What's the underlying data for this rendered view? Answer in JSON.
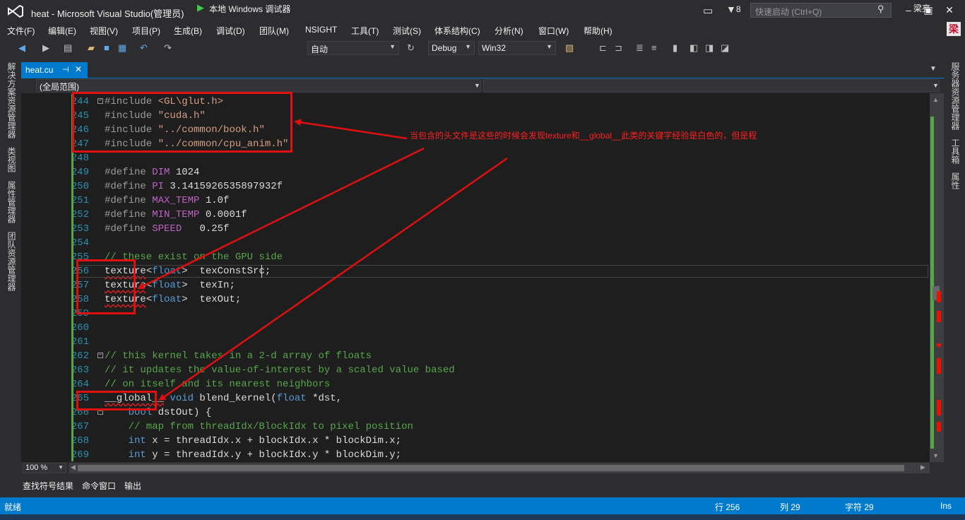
{
  "window": {
    "title": "heat - Microsoft Visual Studio(管理员)",
    "notification_count": "8",
    "quick_launch_placeholder": "快速启动 (Ctrl+Q)",
    "user_name": "梁亮",
    "user_avatar_char": "梁"
  },
  "menu": [
    "文件(F)",
    "编辑(E)",
    "视图(V)",
    "项目(P)",
    "生成(B)",
    "调试(D)",
    "团队(M)",
    "NSIGHT",
    "工具(T)",
    "测试(S)",
    "体系结构(C)",
    "分析(N)",
    "窗口(W)",
    "帮助(H)"
  ],
  "toolbar": {
    "start_debug_label": "本地 Windows 调试器",
    "solution_config": "自动",
    "configuration": "Debug",
    "platform": "Win32"
  },
  "left_tool_tabs": [
    "解决方案资源管理器",
    "类视图",
    "属性管理器",
    "团队资源管理器"
  ],
  "right_tool_tabs": [
    "服务器资源管理器",
    "工具箱",
    "属性"
  ],
  "document_tab": {
    "name": "heat.cu"
  },
  "navigation": {
    "scope": "(全局范围)"
  },
  "code": {
    "l244_n": "244",
    "l244_a": "#include ",
    "l244_b": "<GL\\glut.h>",
    "l245_n": "245",
    "l245_a": "#include ",
    "l245_b": "\"cuda.h\"",
    "l246_n": "246",
    "l246_a": "#include ",
    "l246_b": "\"../common/book.h\"",
    "l247_n": "247",
    "l247_a": "#include ",
    "l247_b": "\"../common/cpu_anim.h\"",
    "l248_n": "248",
    "l249_n": "249",
    "l249_a": "#define ",
    "l249_m": "DIM",
    "l249_v": " 1024",
    "l250_n": "250",
    "l250_a": "#define ",
    "l250_m": "PI",
    "l250_v": " 3.1415926535897932f",
    "l251_n": "251",
    "l251_a": "#define ",
    "l251_m": "MAX_TEMP",
    "l251_v": " 1.0f",
    "l252_n": "252",
    "l252_a": "#define ",
    "l252_m": "MIN_TEMP",
    "l252_v": " 0.0001f",
    "l253_n": "253",
    "l253_a": "#define ",
    "l253_m": "SPEED",
    "l253_v": "   0.25f",
    "l254_n": "254",
    "l255_n": "255",
    "l255_c": "// these exist on the GPU side",
    "l256_n": "256",
    "l256_a": "texture",
    "l256_b": "<",
    "l256_k": "float",
    "l256_c": ">  texConstSrc;",
    "l257_n": "257",
    "l257_a": "texture",
    "l257_b": "<",
    "l257_k": "float",
    "l257_c": ">  texIn;",
    "l258_n": "258",
    "l258_a": "texture",
    "l258_b": "<",
    "l258_k": "float",
    "l258_c": ">  texOut;",
    "l259_n": "259",
    "l260_n": "260",
    "l261_n": "261",
    "l262_n": "262",
    "l262_c": "// this kernel takes in a 2-d array of floats",
    "l263_n": "263",
    "l263_c": "// it updates the value-of-interest by a scaled value based",
    "l264_n": "264",
    "l264_c": "// on itself and its nearest neighbors",
    "l265_n": "265",
    "l265_a": "__global__",
    "l265_b": " ",
    "l265_k": "void",
    "l265_c": " blend_kernel(",
    "l265_k2": "float",
    "l265_d": " *dst,",
    "l266_n": "266",
    "l266_a": "    ",
    "l266_k": "bool",
    "l266_c": " dstOut) {",
    "l267_n": "267",
    "l267_c": "    // map from threadIdx/BlockIdx to pixel position",
    "l268_n": "268",
    "l268_a": "    ",
    "l268_k": "int",
    "l268_c": " x = threadIdx.x + blockIdx.x * blockDim.x;",
    "l269_n": "269",
    "l269_a": "    ",
    "l269_k": "int",
    "l269_c": " y = threadIdx.y + blockIdx.y * blockDim.y;"
  },
  "editor": {
    "zoom": "100 %"
  },
  "bottom_tabs": [
    "查找符号结果",
    "命令窗口",
    "输出"
  ],
  "status": {
    "state": "就绪",
    "line": "行 256",
    "col": "列 29",
    "char": "字符 29",
    "mode": "Ins"
  },
  "annotation": {
    "text": "当包含的头文件是这些的时候会发现texture和__global__此类的关键字经验是白色的，但是程"
  },
  "colors": {
    "accent": "#007acc",
    "annotation_red": "#e01010",
    "editor_bg": "#1e1e1e"
  }
}
